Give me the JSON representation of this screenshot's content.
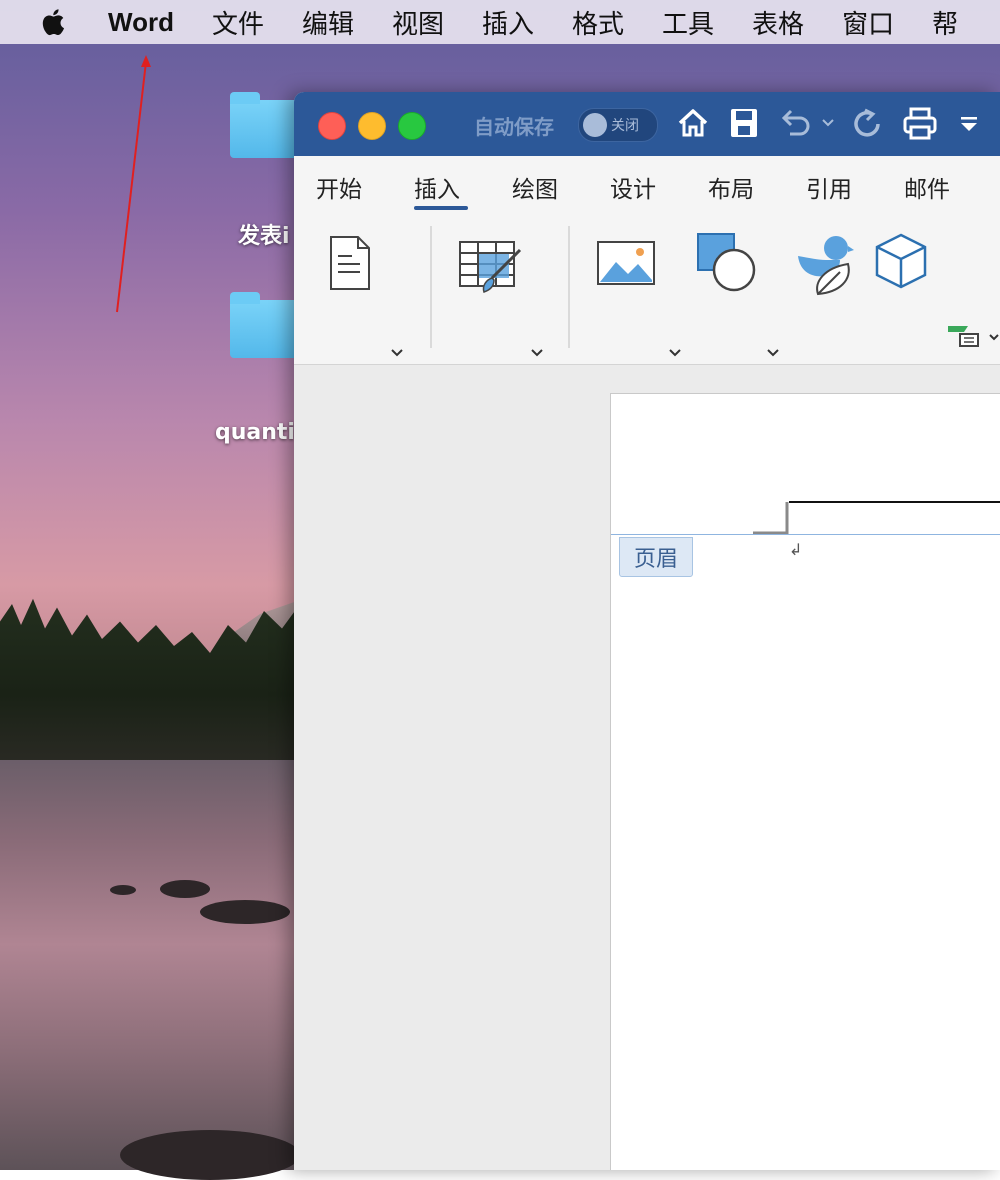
{
  "menubar": {
    "app_name": "Word",
    "items": [
      "文件",
      "编辑",
      "视图",
      "插入",
      "格式",
      "工具",
      "表格",
      "窗口",
      "帮"
    ]
  },
  "desktop": {
    "folders": [
      {
        "label": "发表i"
      },
      {
        "label": "quanti"
      }
    ]
  },
  "window": {
    "autosave_label": "自动保存",
    "autosave_state": "关闭",
    "toolbar_icons": [
      "home-icon",
      "save-icon",
      "undo-icon",
      "undo-dropdown-icon",
      "redo-icon",
      "print-icon",
      "customize-toolbar-icon"
    ]
  },
  "ribbon": {
    "tabs": [
      "开始",
      "插入",
      "绘图",
      "设计",
      "布局",
      "引用",
      "邮件"
    ],
    "active_tab": "插入",
    "buttons": {
      "page": "页面",
      "table": "表格",
      "picture": "图片",
      "shapes": "形状",
      "icons": "图标",
      "model3d_line1": "3D",
      "model3d_line2": "模型"
    }
  },
  "document": {
    "header_tag": "页眉",
    "paragraph_mark": "↲"
  },
  "colors": {
    "titlebar": "#2c5898",
    "accent": "#2c5898",
    "icon_blue": "#3b8dd0"
  }
}
